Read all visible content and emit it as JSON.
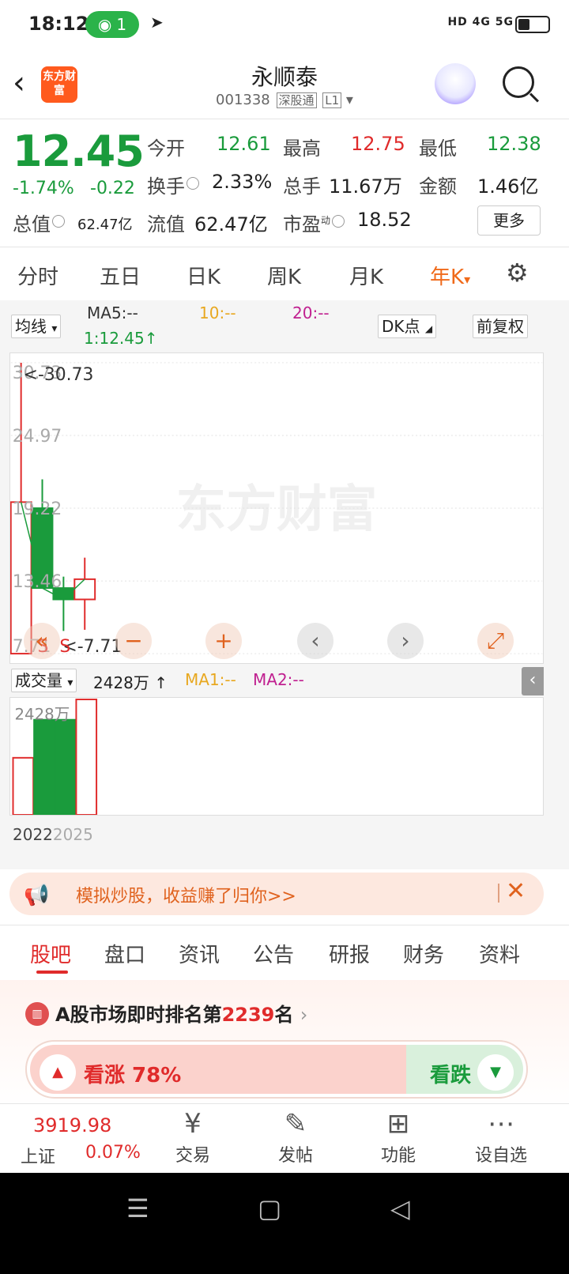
{
  "status_bar": {
    "time": "18:12",
    "hotspot_count": "1",
    "network": "HD 4G 5G"
  },
  "header": {
    "logo_text": "东方财富",
    "stock_name": "永顺泰",
    "stock_code": "001338",
    "tag1": "深股通",
    "tag2": "L1"
  },
  "quote": {
    "price": "12.45",
    "change_pct": "-1.74%",
    "change_abs": "-0.22",
    "open_label": "今开",
    "open": "12.61",
    "high_label": "最高",
    "high": "12.75",
    "low_label": "最低",
    "low": "12.38",
    "turnover_label": "换手",
    "turnover": "2.33%",
    "volume_label": "总手",
    "volume": "11.67万",
    "amount_label": "金额",
    "amount": "1.46亿",
    "mktcap_label": "总值",
    "mktcap": "62.47亿",
    "float_label": "流值",
    "float": "62.47亿",
    "pe_label": "市盈",
    "pe_sup": "动",
    "pe": "18.52",
    "more_button": "更多"
  },
  "period_tabs": [
    "分时",
    "五日",
    "日K",
    "周K",
    "月K",
    "年K"
  ],
  "active_period": "年K",
  "chart_toolbar": {
    "indicator": "均线",
    "ma5": "MA5:--",
    "ma10": "10:--",
    "ma20": "20:--",
    "current": "1:12.45",
    "dk": "DK点",
    "adjust": "前复权"
  },
  "chart_labels": {
    "y_ticks": [
      "30.73",
      "24.97",
      "19.22",
      "13.46",
      "7.71"
    ],
    "max_marker": "<-30.73",
    "min_marker": "<-7.71",
    "s_marks": [
      "S",
      "S"
    ]
  },
  "volume_toolbar": {
    "indicator": "成交量",
    "value": "2428万",
    "ma1": "MA1:--",
    "ma2": "MA2:--",
    "y_label": "2428万"
  },
  "x_labels": [
    "2022",
    "2025"
  ],
  "chart_data": {
    "type": "candlestick",
    "candles": [
      {
        "open": 7.71,
        "close": 19.7,
        "high": 30.73,
        "low": 7.71,
        "color": "red"
      },
      {
        "open": 19.22,
        "close": 12.9,
        "high": 21.5,
        "low": 12.9,
        "color": "green"
      },
      {
        "open": 12.9,
        "close": 12.0,
        "high": 13.8,
        "low": 9.5,
        "color": "green"
      },
      {
        "open": 12.0,
        "close": 13.6,
        "high": 15.3,
        "low": 9.6,
        "color": "red"
      }
    ],
    "volumes": [
      {
        "value": 1200,
        "color": "red"
      },
      {
        "value": 2000,
        "color": "green"
      },
      {
        "value": 2000,
        "color": "green"
      },
      {
        "value": 2428,
        "color": "red"
      }
    ],
    "ylim": [
      7.71,
      30.73
    ],
    "vol_max": 2428
  },
  "chart_controls": [
    "«",
    "−",
    "+",
    "‹",
    "›",
    "⤢"
  ],
  "watermark": "东方财富",
  "promo": {
    "text": "模拟炒股，收益赚了归你>>"
  },
  "info_tabs": [
    "股吧",
    "盘口",
    "资讯",
    "公告",
    "研报",
    "财务",
    "资料"
  ],
  "active_info_tab": "股吧",
  "ranking": {
    "prefix": "A股市场即时排名第",
    "rank": "2239",
    "suffix": "名"
  },
  "vote": {
    "up_label": "看涨 78%",
    "down_label": "看跌"
  },
  "bottom_bar": {
    "index_value": "3919.98",
    "index_name": "上证",
    "index_pct": "0.07%",
    "items": [
      {
        "label": "交易",
        "icon": "yen-icon"
      },
      {
        "label": "发帖",
        "icon": "edit-icon"
      },
      {
        "label": "功能",
        "icon": "grid-icon"
      },
      {
        "label": "设自选",
        "icon": "more-icon"
      }
    ]
  },
  "colors": {
    "up": "#e02b2b",
    "down": "#1a9b3c",
    "accent": "#f06a1a"
  }
}
